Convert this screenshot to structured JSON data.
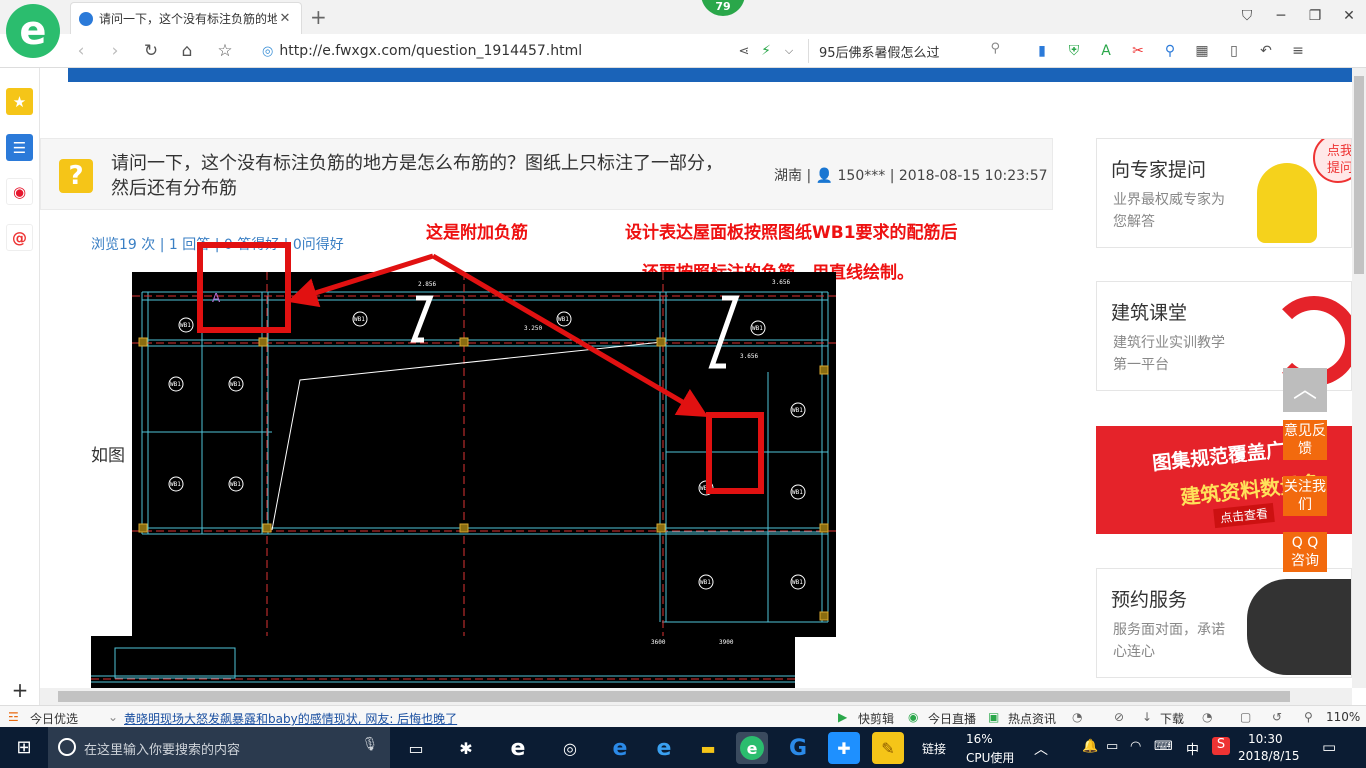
{
  "browser": {
    "tab_title": "请问一下，这个没有标注负筋的地",
    "badge": "79",
    "url": "http://e.fwxgx.com/question_1914457.html",
    "search_text": "95后佛系暑假怎么过"
  },
  "question": {
    "title": "请问一下，这个没有标注负筋的地方是怎么布筋的？图纸上只标注了一部分，然后还有分布筋",
    "region": "湖南",
    "user": "150***",
    "datetime": "2018-08-15 10:23:57",
    "stats": "浏览19 次 | 1 回答 | 0 答得好 | 0问得好",
    "body_text": "如图"
  },
  "annotations": {
    "extra_neg_rebar": "这是附加负筋",
    "design_line1": "设计表达屋面板按照图纸WB1要求的配筋后",
    "design_line2": "，还要按照标注的负筋，用直线绘制。"
  },
  "cad": {
    "label_wb1": "WB1",
    "label_a": "A",
    "dim1": "2.856",
    "dim2": "3.250",
    "dim3": "3.656",
    "dim4": "3600",
    "dim5": "3900"
  },
  "sidebar": {
    "expert_title": "向专家提问",
    "expert_sub": "业界最权威专家为您解答",
    "expert_bubble": "点我提问",
    "class_title": "建筑课堂",
    "class_sub": "建筑行业实训教学第一平台",
    "banner_line1": "图集规范覆盖广",
    "banner_line2": "建筑资料数量多",
    "banner_btn": "点击查看",
    "booking_title": "预约服务",
    "booking_sub": "服务面对面，承诺心连心",
    "feedback": "意见反馈",
    "follow": "关注我们",
    "qq": "Q Q 咨询"
  },
  "statusbar": {
    "today": "今日优选",
    "news": "黄晓明现场大怒发飙暴露和baby的感情现状, 网友: 后悔也晚了",
    "quickcut": "快剪辑",
    "live": "今日直播",
    "hotnews": "热点资讯",
    "download": "下载",
    "zoom": "110%"
  },
  "taskbar": {
    "search_placeholder": "在这里输入你要搜索的内容",
    "links": "链接",
    "cpu_pct": "16%",
    "cpu_label": "CPU使用",
    "ime": "中",
    "time": "10:30",
    "date": "2018/8/15"
  },
  "colors": {
    "brand_blue": "#1a63b8",
    "annotation_red": "#e11111",
    "float_orange": "#f26a0e"
  }
}
